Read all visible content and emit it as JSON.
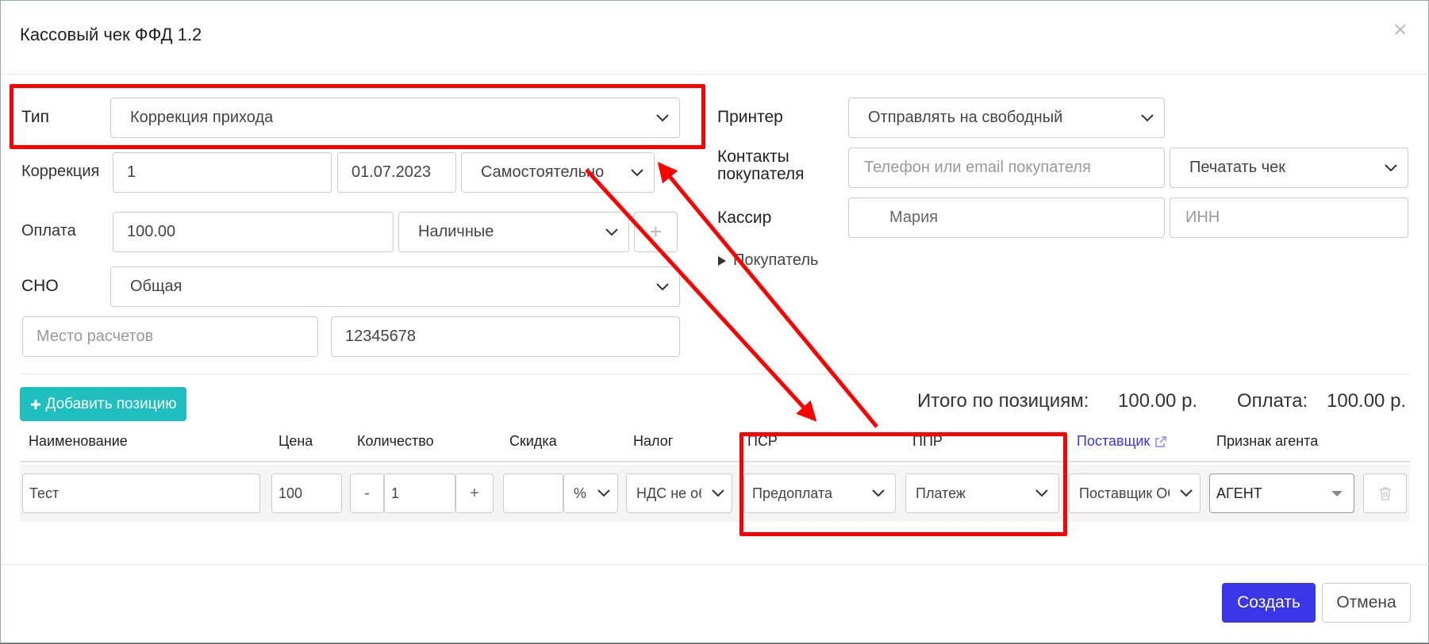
{
  "dialog": {
    "title": "Кассовый чек ФФД 1.2",
    "close": "×"
  },
  "left": {
    "type_label": "Тип",
    "type_value": "Коррекция прихода",
    "correction_label": "Коррекция",
    "correction_number": "1",
    "correction_date": "01.07.2023",
    "correction_kind": "Самостоятельно",
    "payment_label": "Оплата",
    "payment_amount": "100.00",
    "payment_method": "Наличные",
    "payment_add": "+",
    "sno_label": "СНО",
    "sno_value": "Общая",
    "place_placeholder": "Место расчетов",
    "place_code": "12345678"
  },
  "right": {
    "printer_label": "Принтер",
    "printer_value": "Отправлять на свободный",
    "contacts_label_1": "Контакты",
    "contacts_label_2": "покупателя",
    "contacts_placeholder": "Телефон или email покупателя",
    "print_mode": "Печатать чек",
    "cashier_label": "Кассир",
    "cashier_name": "Мария",
    "inn_placeholder": "ИНН",
    "buyer_toggle": "Покупатель"
  },
  "items": {
    "add_button": "Добавить позицию",
    "total_label": "Итого по позициям:",
    "total_value": "100.00 р.",
    "paid_label": "Оплата:",
    "paid_value": "100.00 р.",
    "headers": {
      "name": "Наименование",
      "price": "Цена",
      "qty": "Количество",
      "discount": "Скидка",
      "tax": "Налог",
      "psr": "ПСР",
      "ppr": "ППР",
      "supplier": "Поставщик",
      "agent": "Признак агента"
    },
    "row": {
      "name": "Тест",
      "price": "100",
      "minus": "-",
      "qty": "1",
      "plus": "+",
      "discount": "",
      "discount_unit": "%",
      "tax": "НДС не облагается",
      "psr": "Предоплата",
      "ppr": "Платеж",
      "supplier": "Поставщик ООО",
      "agent": "АГЕНТ"
    }
  },
  "footer": {
    "create": "Создать",
    "cancel": "Отмена"
  },
  "colors": {
    "accent_teal": "#1fbfbf",
    "primary_blue": "#3b35e8",
    "annotation_red": "#ff0000",
    "link_blue": "#3b35e8"
  }
}
